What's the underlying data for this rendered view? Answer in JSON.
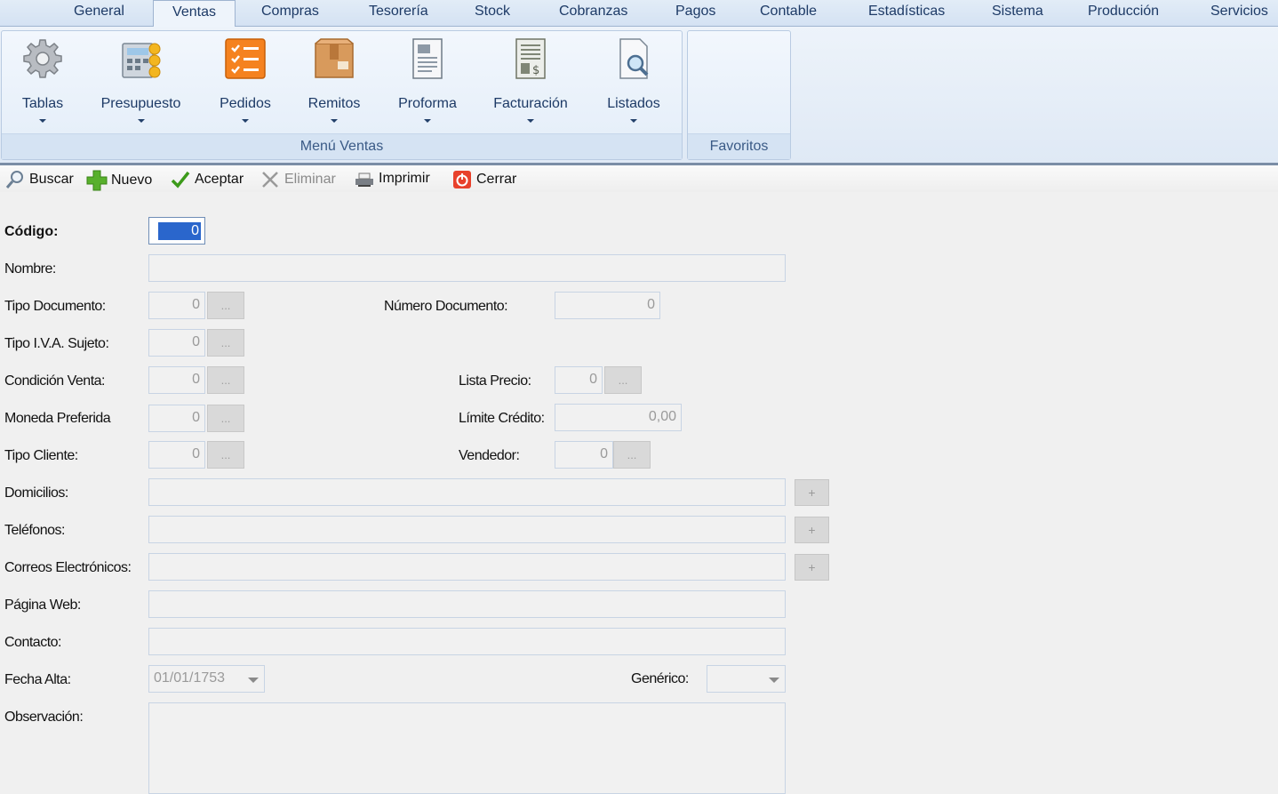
{
  "menu_tabs": [
    {
      "label": "General"
    },
    {
      "label": "Ventas"
    },
    {
      "label": "Compras"
    },
    {
      "label": "Tesorería"
    },
    {
      "label": "Stock"
    },
    {
      "label": "Cobranzas"
    },
    {
      "label": "Pagos"
    },
    {
      "label": "Contable"
    },
    {
      "label": "Estadísticas"
    },
    {
      "label": "Sistema"
    },
    {
      "label": "Producción"
    },
    {
      "label": "Servicios"
    }
  ],
  "active_tab": "Ventas",
  "ribbon": {
    "ventas_group": {
      "label": "Menú Ventas",
      "buttons": [
        {
          "label": "Tablas",
          "icon": "gear-icon"
        },
        {
          "label": "Presupuesto",
          "icon": "budget-icon"
        },
        {
          "label": "Pedidos",
          "icon": "checklist-icon"
        },
        {
          "label": "Remitos",
          "icon": "package-icon"
        },
        {
          "label": "Proforma",
          "icon": "document-icon"
        },
        {
          "label": "Facturación",
          "icon": "invoice-icon"
        },
        {
          "label": "Listados",
          "icon": "magnifier-document-icon"
        }
      ]
    },
    "favoritos_group": {
      "label": "Favoritos"
    }
  },
  "toolbar": {
    "buscar": "Buscar",
    "nuevo": "Nuevo",
    "aceptar": "Aceptar",
    "eliminar": "Eliminar",
    "imprimir": "Imprimir",
    "cerrar": "Cerrar"
  },
  "form": {
    "codigo": {
      "label": "Código:",
      "value": "0"
    },
    "nombre": {
      "label": "Nombre:",
      "value": ""
    },
    "tipo_documento": {
      "label": "Tipo Documento:",
      "value": "0"
    },
    "numero_documento": {
      "label": "Número Documento:",
      "value": "0"
    },
    "tipo_iva": {
      "label": "Tipo I.V.A. Sujeto:",
      "value": "0"
    },
    "condicion_venta": {
      "label": "Condición Venta:",
      "value": "0"
    },
    "lista_precio": {
      "label": "Lista Precio:",
      "value": "0"
    },
    "moneda": {
      "label": "Moneda Preferida",
      "value": "0"
    },
    "limite_credito": {
      "label": "Límite Crédito:",
      "value": "0,00"
    },
    "tipo_cliente": {
      "label": "Tipo Cliente:",
      "value": "0"
    },
    "vendedor": {
      "label": "Vendedor:",
      "value": "0"
    },
    "domicilios": {
      "label": "Domicilios:",
      "value": ""
    },
    "telefonos": {
      "label": "Teléfonos:",
      "value": ""
    },
    "correos": {
      "label": "Correos Electrónicos:",
      "value": ""
    },
    "pagina_web": {
      "label": "Página Web:",
      "value": ""
    },
    "contacto": {
      "label": "Contacto:",
      "value": ""
    },
    "fecha_alta": {
      "label": "Fecha Alta:",
      "value": "01/01/1753"
    },
    "generico": {
      "label": "Genérico:",
      "value": ""
    },
    "observacion": {
      "label": "Observación:",
      "value": ""
    },
    "lookup_button": "...",
    "add_button": "+"
  },
  "colors": {
    "ribbon_bg": "#dfe9f5",
    "tab_text": "#1d3a66",
    "selection": "#2a66cc",
    "field_disabled": "#f1f1f1"
  }
}
